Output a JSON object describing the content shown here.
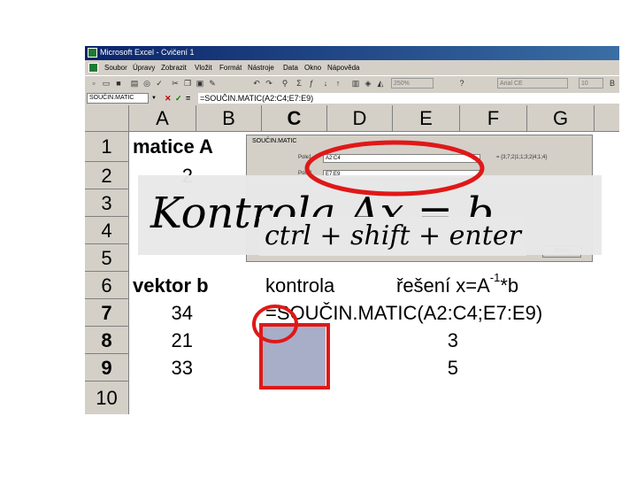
{
  "window": {
    "title": "Microsoft Excel - Cvičení 1"
  },
  "menu": {
    "items": [
      "Soubor",
      "Úpravy",
      "Zobrazit",
      "Vložit",
      "Formát",
      "Nástroje",
      "Data",
      "Okno",
      "Nápověda"
    ]
  },
  "toolbar": {
    "zoom": "250%",
    "font": "Arial CE",
    "font_size": "10"
  },
  "formula_bar": {
    "name_box": "SOUČIN.MATIC",
    "formula": "=SOUČIN.MATIC(A2:C4;E7:E9)"
  },
  "columns": [
    "A",
    "B",
    "C",
    "D",
    "E",
    "F",
    "G"
  ],
  "rows": [
    "1",
    "2",
    "3",
    "4",
    "5",
    "6",
    "7",
    "8",
    "9",
    "10"
  ],
  "cells": {
    "a1": "matice A",
    "a2": "2",
    "a6": "vektor b",
    "c6": "kontrola",
    "e6_pre": "řešení x=A",
    "e6_sup": "-1",
    "e6_post": "*b",
    "a7": "34",
    "a8": "21",
    "a9": "33",
    "c7": "=SOUČIN.MATIC(A2:C4;E7:E9)",
    "e8": "3",
    "e9": "5"
  },
  "dialog": {
    "title": "SOUČIN.MATIC",
    "label1": "Pole1",
    "value1": "A2:C4",
    "result1": "= {3;7;2|1;1;3;2|4;1;4}",
    "label2": "Pole2",
    "value2": "E7:E9",
    "button": "Storno"
  },
  "overlay": {
    "title": "Kontrola Ax = b",
    "subtitle": "ctrl + shift + enter"
  },
  "colors": {
    "annotation_red": "#e01818",
    "selection_fill": "#a8aec8",
    "titlebar": "#0a246a"
  }
}
